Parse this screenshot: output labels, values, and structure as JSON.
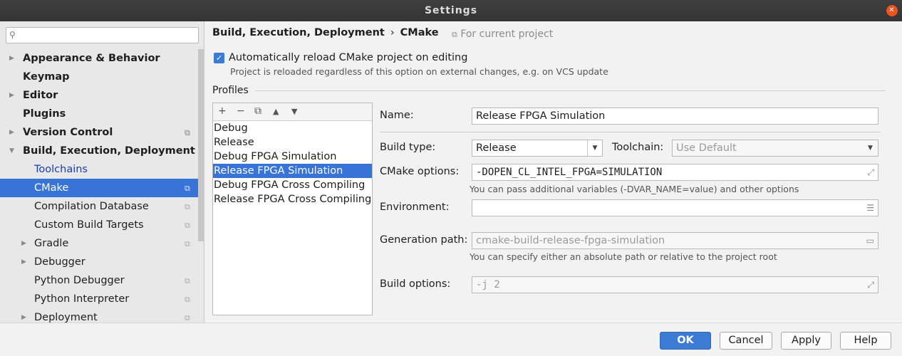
{
  "window": {
    "title": "Settings",
    "close_glyph": "✕"
  },
  "search": {
    "icon": "search-icon",
    "placeholder": ""
  },
  "tree": [
    {
      "label": "Appearance & Behavior",
      "expandable": true
    },
    {
      "label": "Keymap",
      "expandable": false
    },
    {
      "label": "Editor",
      "expandable": true
    },
    {
      "label": "Plugins",
      "expandable": false
    },
    {
      "label": "Version Control",
      "expandable": true,
      "project": true
    },
    {
      "label": "Build, Execution, Deployment",
      "expanded": true
    },
    {
      "label": "Toolchains"
    },
    {
      "label": "CMake",
      "project": true,
      "selected": true
    },
    {
      "label": "Compilation Database",
      "project": true
    },
    {
      "label": "Custom Build Targets",
      "project": true
    },
    {
      "label": "Gradle",
      "expandable": true,
      "project": true
    },
    {
      "label": "Debugger",
      "expandable": true
    },
    {
      "label": "Python Debugger",
      "project": true
    },
    {
      "label": "Python Interpreter",
      "project": true
    },
    {
      "label": "Deployment",
      "expandable": true,
      "project": true
    }
  ],
  "breadcrumb": {
    "parent": "Build, Execution, Deployment",
    "separator": "›",
    "current": "CMake"
  },
  "for_current_project": "For current project",
  "auto_reload": {
    "checked": true,
    "label": "Automatically reload CMake project on editing",
    "hint": "Project is reloaded regardless of this option on external changes, e.g. on VCS update"
  },
  "profiles": {
    "title": "Profiles",
    "toolbar": [
      "+",
      "−",
      "⧉",
      "▲",
      "▼"
    ],
    "items": [
      "Debug",
      "Release",
      "Debug FPGA Simulation",
      "Release FPGA Simulation",
      "Debug FPGA Cross Compiling",
      "Release FPGA Cross Compiling"
    ],
    "selected": "Release FPGA Simulation"
  },
  "form": {
    "name_label": "Name:",
    "name_value": "Release FPGA Simulation",
    "build_type_label": "Build type:",
    "build_type_value": "Release",
    "toolchain_label": "Toolchain:",
    "toolchain_value": "Use Default",
    "cmake_options_label": "CMake options:",
    "cmake_options_value": "-DOPEN_CL_INTEL_FPGA=SIMULATION",
    "cmake_options_hint": "You can pass additional variables (-DVAR_NAME=value) and other options",
    "environment_label": "Environment:",
    "environment_value": "",
    "generation_path_label": "Generation path:",
    "generation_path_value": "cmake-build-release-fpga-simulation",
    "generation_path_hint": "You can specify either an absolute path or relative to the project root",
    "build_options_label": "Build options:",
    "build_options_value": "-j 2"
  },
  "buttons": {
    "ok": "OK",
    "cancel": "Cancel",
    "apply": "Apply",
    "help": "Help"
  },
  "colors": {
    "accent": "#3874d8",
    "title_bar": "#3a3a3a",
    "close": "#e95420",
    "link": "#1a3cb5"
  }
}
